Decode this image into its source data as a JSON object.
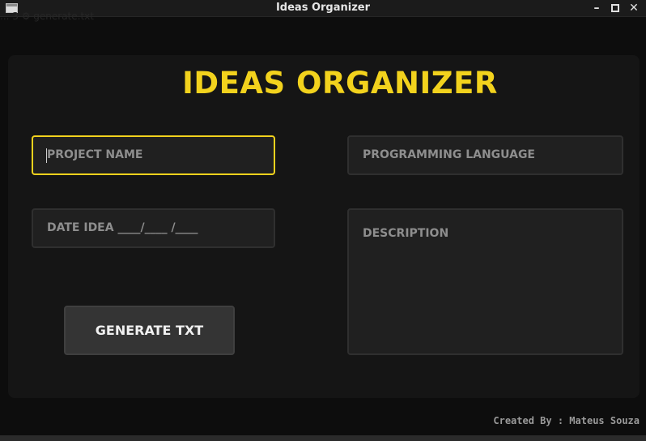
{
  "window": {
    "title": "Ideas Organizer",
    "ghost_text": "... 3 ⚙ generate.txt",
    "icons": [
      "app-icon",
      "minimize-icon",
      "maximize-icon",
      "close-icon"
    ]
  },
  "main": {
    "heading": "IDEAS ORGANIZER",
    "fields": {
      "project_name": {
        "placeholder": "PROJECT NAME",
        "value": ""
      },
      "programming_language": {
        "placeholder": "PROGRAMMING LANGUAGE",
        "value": ""
      },
      "date_idea": {
        "placeholder": "DATE IDEA ____/____ /____",
        "value": ""
      },
      "description": {
        "placeholder": "DESCRIPTION",
        "value": ""
      }
    },
    "generate_button": "GENERATE TXT"
  },
  "footer": {
    "credits": "Created By : Mateus Souza"
  },
  "colors": {
    "accent": "#f2d21d",
    "background": "#0d0d0d",
    "panel": "#151515",
    "field": "#202020",
    "button": "#343434"
  }
}
